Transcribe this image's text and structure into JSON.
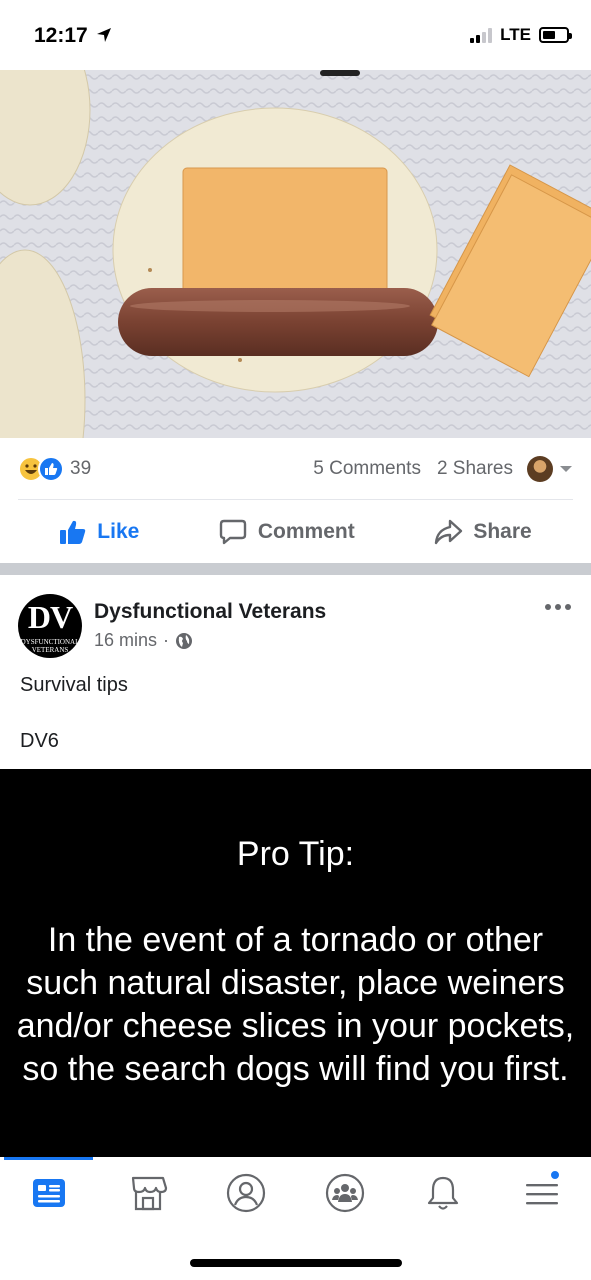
{
  "status_bar": {
    "time": "12:17",
    "network": "LTE",
    "location_icon": "location-arrow-icon",
    "signal_bars": 2,
    "battery_level": 0.55
  },
  "post_one": {
    "photo": "tortilla with cheese slice and hot dog",
    "reactions": {
      "icons": [
        "haha-icon",
        "like-icon"
      ],
      "count": "39"
    },
    "comments": "5 Comments",
    "shares": "2 Shares",
    "actions": {
      "like": "Like",
      "comment": "Comment",
      "share": "Share"
    }
  },
  "post_two": {
    "page_name": "Dysfunctional Veterans",
    "avatar_text": "DV",
    "avatar_subtext": "DYSFUNCTIONAL VETERANS",
    "time": "16 mins",
    "separator": "·",
    "audience_icon": "globe-icon",
    "text_lines": [
      "Survival tips",
      "DV6"
    ],
    "image": {
      "title": "Pro Tip:",
      "body": "In the event of a tornado or other such natural disaster, place weiners and/or cheese slices in your pockets, so the search dogs will find you first."
    }
  },
  "tab_bar": {
    "tabs": [
      "news-feed-icon",
      "marketplace-icon",
      "profile-icon",
      "groups-icon",
      "notifications-icon",
      "menu-icon"
    ],
    "active": 0
  },
  "colors": {
    "accent": "#1877f2",
    "secondary_text": "#65676b",
    "separator": "#c9ccd1"
  }
}
